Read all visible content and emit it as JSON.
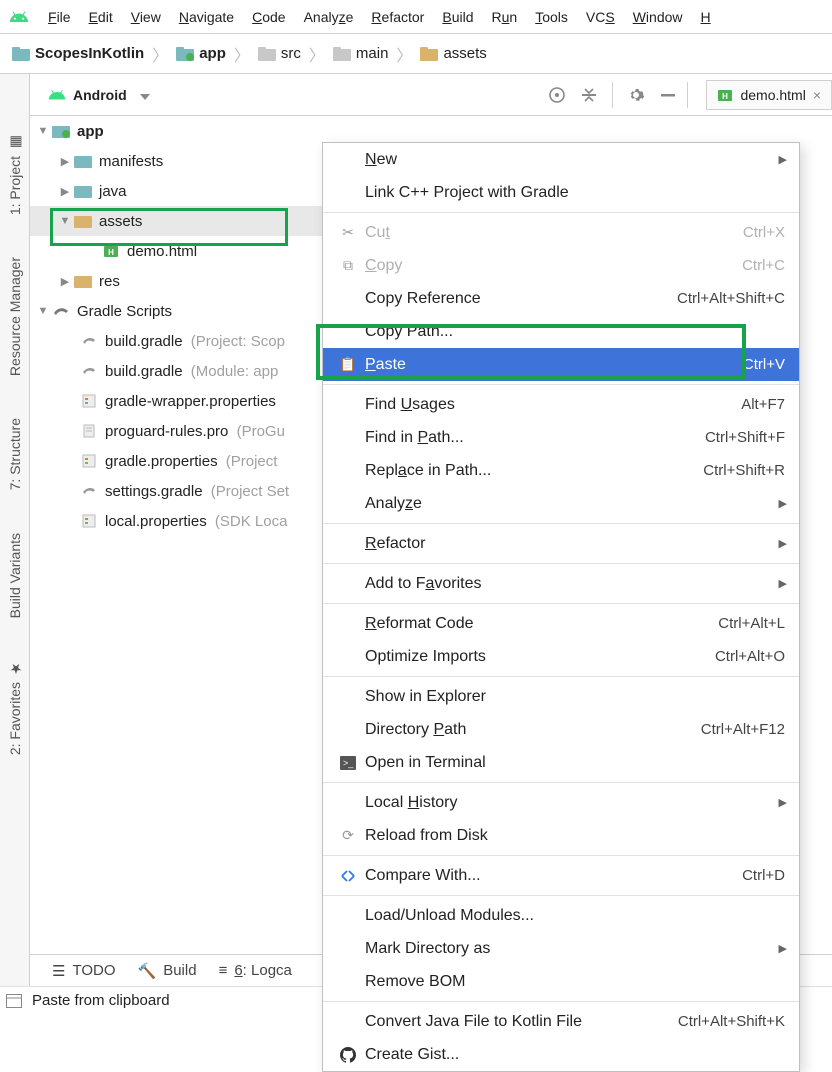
{
  "menubar": {
    "items": [
      "File",
      "Edit",
      "View",
      "Navigate",
      "Code",
      "Analyze",
      "Refactor",
      "Build",
      "Run",
      "Tools",
      "VCS",
      "Window",
      "H"
    ]
  },
  "breadcrumb": {
    "segs": [
      "ScopesInKotlin",
      "app",
      "src",
      "main",
      "assets"
    ]
  },
  "panel": {
    "title": "Android",
    "tab_file": "demo.html"
  },
  "gutters": {
    "labels": [
      "1: Project",
      "Resource Manager",
      "7: Structure",
      "Build Variants",
      "2: Favorites"
    ]
  },
  "tree": {
    "app": "app",
    "manifests": "manifests",
    "java": "java",
    "assets": "assets",
    "demo": "demo.html",
    "res": "res",
    "gradle_scripts": "Gradle Scripts",
    "bg1": "build.gradle",
    "bg1_hint": "(Project: Scop",
    "bg2": "build.gradle",
    "bg2_hint": "(Module: app",
    "gwp": "gradle-wrapper.properties",
    "pg": "proguard-rules.pro",
    "pg_hint": "(ProGu",
    "gp": "gradle.properties",
    "gp_hint": "(Project ",
    "sg": "settings.gradle",
    "sg_hint": "(Project Set",
    "lp": "local.properties",
    "lp_hint": "(SDK Loca"
  },
  "ctx": {
    "new": "New",
    "link": "Link C++ Project with Gradle",
    "cut": "Cut",
    "cut_sc": "Ctrl+X",
    "copy": "Copy",
    "copy_sc": "Ctrl+C",
    "copyref": "Copy Reference",
    "copyref_sc": "Ctrl+Alt+Shift+C",
    "copypath": "Copy Path...",
    "paste": "Paste",
    "paste_sc": "Ctrl+V",
    "findu": "Find Usages",
    "findu_sc": "Alt+F7",
    "findp": "Find in Path...",
    "findp_sc": "Ctrl+Shift+F",
    "repp": "Replace in Path...",
    "repp_sc": "Ctrl+Shift+R",
    "analyze": "Analyze",
    "refactor": "Refactor",
    "fav": "Add to Favorites",
    "reformat": "Reformat Code",
    "reformat_sc": "Ctrl+Alt+L",
    "optimp": "Optimize Imports",
    "optimp_sc": "Ctrl+Alt+O",
    "showex": "Show in Explorer",
    "dirp": "Directory Path",
    "dirp_sc": "Ctrl+Alt+F12",
    "openterm": "Open in Terminal",
    "localh": "Local History",
    "reload": "Reload from Disk",
    "compare": "Compare With...",
    "compare_sc": "Ctrl+D",
    "loadmod": "Load/Unload Modules...",
    "markdir": "Mark Directory as",
    "rmbom": "Remove BOM",
    "convert": "Convert Java File to Kotlin File",
    "convert_sc": "Ctrl+Alt+Shift+K",
    "gist": "Create Gist..."
  },
  "bottombar": {
    "todo": "TODO",
    "build": "Build",
    "logcat": "6: Logca"
  },
  "status": {
    "text": "Paste from clipboard"
  }
}
